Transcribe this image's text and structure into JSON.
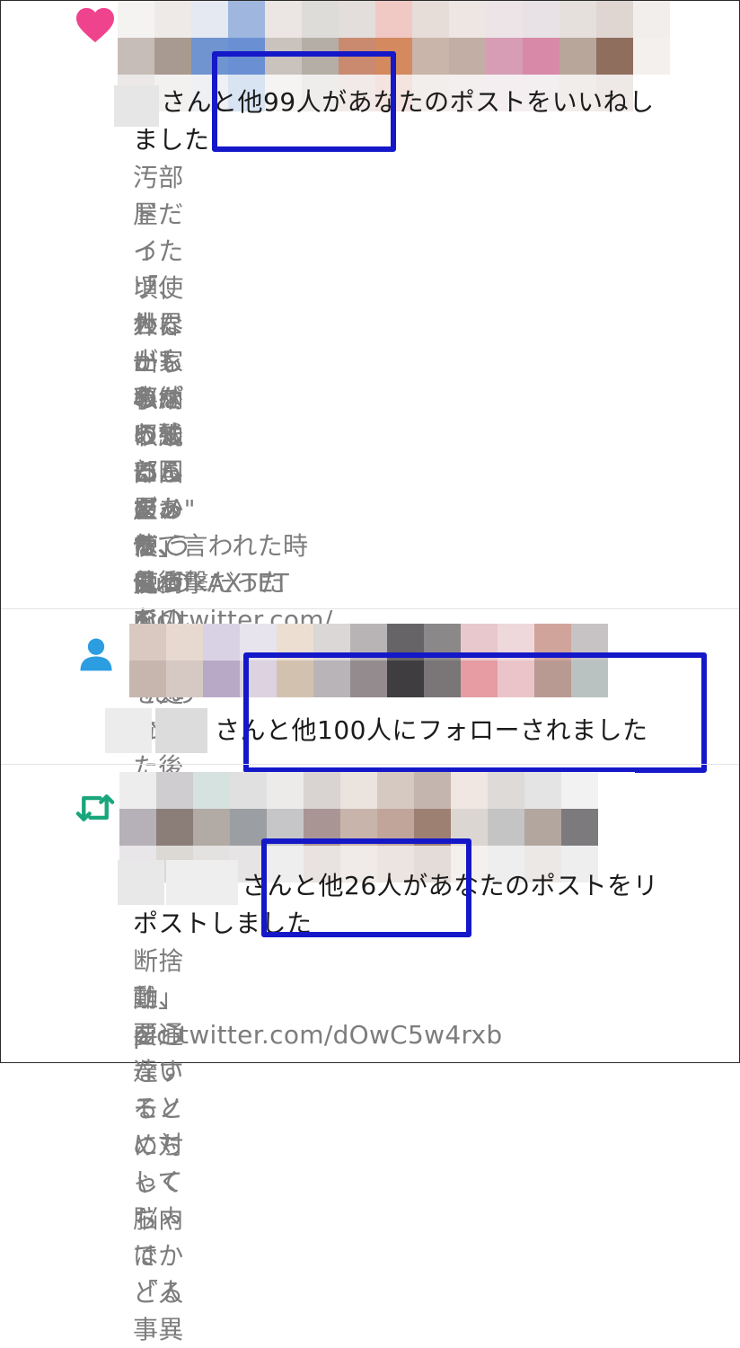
{
  "notifications": [
    {
      "kind": "like",
      "icon": "heart-icon",
      "icon_color": "#f0438e",
      "headline_line1": "さんと他99人があなたのポストをいいねし",
      "headline_line2": "ました",
      "body_lines": [
        "汚部屋だった頃、世界一家事がうまい国である",
        "ドイツ人が私の部屋を見て",
        "",
        "「使わないものを収納にしまって、使うものを",
        "外に出しっぱにしたらダメだよ。",
        "",
        "収納っていうのは、使わないモノを処分した後",
        "に残った、\" 使 う も の を し ま う \"ためにあ",
        "るんだから」",
        "",
        "って言われた時は衝撃だった pic.twitter.com/",
        "FuwfkAXTET"
      ]
    },
    {
      "kind": "follow",
      "icon": "person-icon",
      "icon_color": "#2b9de0",
      "headline_line1": "さんと他100人にフォローされました"
    },
    {
      "kind": "repost",
      "icon": "repost-icon",
      "icon_color": "#1aa67c",
      "headline_line1": "さんと他26人があなたのポストをリ",
      "headline_line2": "ポストしました",
      "body_lines": [
        "断捨離、要らないモノに対して脳内で「人事異",
        "動」を通達するとめちゃくちゃはかどる",
        "pic.twitter.com/dOwC5w4rxb"
      ]
    }
  ],
  "highlight_color": "#1418c8"
}
